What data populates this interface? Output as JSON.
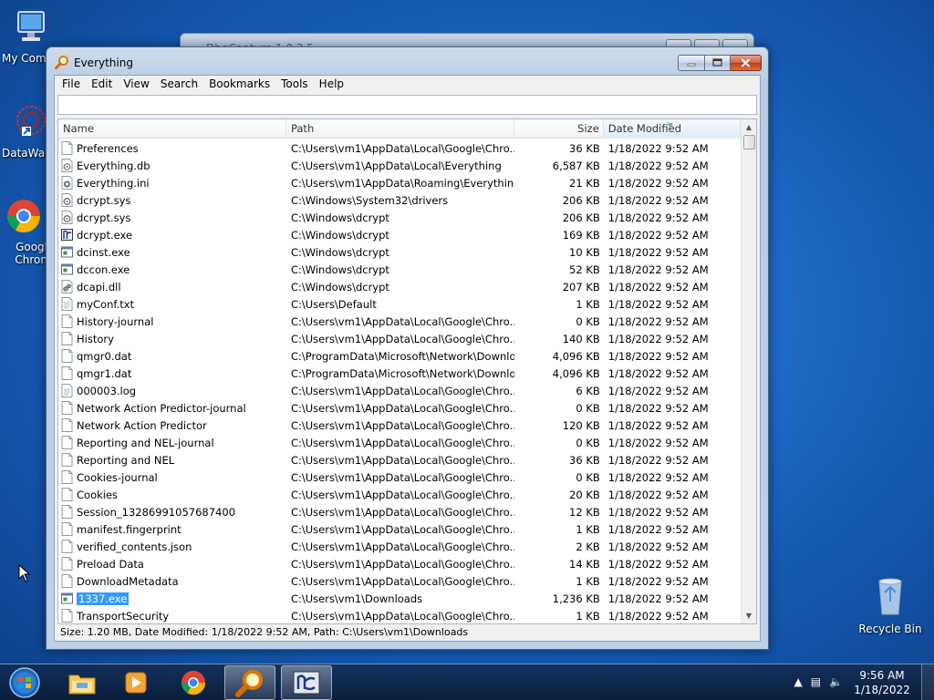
{
  "desktop": {
    "icons": [
      {
        "label": "My Comp",
        "icon": "computer-icon"
      },
      {
        "label": "DataWag",
        "icon": "datawag-icon"
      },
      {
        "label": "Googl\nChron",
        "icon": "chrome-icon"
      },
      {
        "label": "Recycle Bin",
        "icon": "recycle-bin-icon"
      }
    ]
  },
  "background_window": {
    "title": "DbgCapture 1.0.3.5"
  },
  "window": {
    "title": "Everything",
    "menu": [
      "File",
      "Edit",
      "View",
      "Search",
      "Bookmarks",
      "Tools",
      "Help"
    ],
    "search": {
      "value": "",
      "placeholder": ""
    },
    "columns": {
      "name": "Name",
      "path": "Path",
      "size": "Size",
      "date": "Date Modified"
    },
    "sorted_column": "Date Modified",
    "rows": [
      {
        "name": "Preferences",
        "path": "C:\\Users\\vm1\\AppData\\Local\\Google\\Chro...",
        "size": "36 KB",
        "date": "1/18/2022 9:52 AM",
        "icon": "file"
      },
      {
        "name": "Everything.db",
        "path": "C:\\Users\\vm1\\AppData\\Local\\Everything",
        "size": "6,587 KB",
        "date": "1/18/2022 9:52 AM",
        "icon": "db"
      },
      {
        "name": "Everything.ini",
        "path": "C:\\Users\\vm1\\AppData\\Roaming\\Everything",
        "size": "21 KB",
        "date": "1/18/2022 9:52 AM",
        "icon": "ini"
      },
      {
        "name": "dcrypt.sys",
        "path": "C:\\Windows\\System32\\drivers",
        "size": "206 KB",
        "date": "1/18/2022 9:52 AM",
        "icon": "sys"
      },
      {
        "name": "dcrypt.sys",
        "path": "C:\\Windows\\dcrypt",
        "size": "206 KB",
        "date": "1/18/2022 9:52 AM",
        "icon": "sys"
      },
      {
        "name": "dcrypt.exe",
        "path": "C:\\Windows\\dcrypt",
        "size": "169 KB",
        "date": "1/18/2022 9:52 AM",
        "icon": "dcexe"
      },
      {
        "name": "dcinst.exe",
        "path": "C:\\Windows\\dcrypt",
        "size": "10 KB",
        "date": "1/18/2022 9:52 AM",
        "icon": "exe"
      },
      {
        "name": "dccon.exe",
        "path": "C:\\Windows\\dcrypt",
        "size": "52 KB",
        "date": "1/18/2022 9:52 AM",
        "icon": "exe"
      },
      {
        "name": "dcapi.dll",
        "path": "C:\\Windows\\dcrypt",
        "size": "207 KB",
        "date": "1/18/2022 9:52 AM",
        "icon": "dll"
      },
      {
        "name": "myConf.txt",
        "path": "C:\\Users\\Default",
        "size": "1 KB",
        "date": "1/18/2022 9:52 AM",
        "icon": "txt"
      },
      {
        "name": "History-journal",
        "path": "C:\\Users\\vm1\\AppData\\Local\\Google\\Chro...",
        "size": "0 KB",
        "date": "1/18/2022 9:52 AM",
        "icon": "file"
      },
      {
        "name": "History",
        "path": "C:\\Users\\vm1\\AppData\\Local\\Google\\Chro...",
        "size": "140 KB",
        "date": "1/18/2022 9:52 AM",
        "icon": "file"
      },
      {
        "name": "qmgr0.dat",
        "path": "C:\\ProgramData\\Microsoft\\Network\\Downlo...",
        "size": "4,096 KB",
        "date": "1/18/2022 9:52 AM",
        "icon": "file"
      },
      {
        "name": "qmgr1.dat",
        "path": "C:\\ProgramData\\Microsoft\\Network\\Downlo...",
        "size": "4,096 KB",
        "date": "1/18/2022 9:52 AM",
        "icon": "file"
      },
      {
        "name": "000003.log",
        "path": "C:\\Users\\vm1\\AppData\\Local\\Google\\Chro...",
        "size": "6 KB",
        "date": "1/18/2022 9:52 AM",
        "icon": "txt"
      },
      {
        "name": "Network Action Predictor-journal",
        "path": "C:\\Users\\vm1\\AppData\\Local\\Google\\Chro...",
        "size": "0 KB",
        "date": "1/18/2022 9:52 AM",
        "icon": "file"
      },
      {
        "name": "Network Action Predictor",
        "path": "C:\\Users\\vm1\\AppData\\Local\\Google\\Chro...",
        "size": "120 KB",
        "date": "1/18/2022 9:52 AM",
        "icon": "file"
      },
      {
        "name": "Reporting and NEL-journal",
        "path": "C:\\Users\\vm1\\AppData\\Local\\Google\\Chro...",
        "size": "0 KB",
        "date": "1/18/2022 9:52 AM",
        "icon": "file"
      },
      {
        "name": "Reporting and NEL",
        "path": "C:\\Users\\vm1\\AppData\\Local\\Google\\Chro...",
        "size": "36 KB",
        "date": "1/18/2022 9:52 AM",
        "icon": "file"
      },
      {
        "name": "Cookies-journal",
        "path": "C:\\Users\\vm1\\AppData\\Local\\Google\\Chro...",
        "size": "0 KB",
        "date": "1/18/2022 9:52 AM",
        "icon": "file"
      },
      {
        "name": "Cookies",
        "path": "C:\\Users\\vm1\\AppData\\Local\\Google\\Chro...",
        "size": "20 KB",
        "date": "1/18/2022 9:52 AM",
        "icon": "file"
      },
      {
        "name": "Session_13286991057687400",
        "path": "C:\\Users\\vm1\\AppData\\Local\\Google\\Chro...",
        "size": "12 KB",
        "date": "1/18/2022 9:52 AM",
        "icon": "file"
      },
      {
        "name": "manifest.fingerprint",
        "path": "C:\\Users\\vm1\\AppData\\Local\\Google\\Chro...",
        "size": "1 KB",
        "date": "1/18/2022 9:52 AM",
        "icon": "file"
      },
      {
        "name": "verified_contents.json",
        "path": "C:\\Users\\vm1\\AppData\\Local\\Google\\Chro...",
        "size": "2 KB",
        "date": "1/18/2022 9:52 AM",
        "icon": "file"
      },
      {
        "name": "Preload Data",
        "path": "C:\\Users\\vm1\\AppData\\Local\\Google\\Chro...",
        "size": "14 KB",
        "date": "1/18/2022 9:52 AM",
        "icon": "file"
      },
      {
        "name": "DownloadMetadata",
        "path": "C:\\Users\\vm1\\AppData\\Local\\Google\\Chro...",
        "size": "1 KB",
        "date": "1/18/2022 9:52 AM",
        "icon": "file"
      },
      {
        "name": "1337.exe",
        "path": "C:\\Users\\vm1\\Downloads",
        "size": "1,236 KB",
        "date": "1/18/2022 9:52 AM",
        "icon": "exe",
        "selected": true
      },
      {
        "name": "TransportSecurity",
        "path": "C:\\Users\\vm1\\AppData\\Local\\Google\\Chro...",
        "size": "1 KB",
        "date": "1/18/2022 9:52 AM",
        "icon": "file"
      }
    ],
    "status": "Size: 1.20 MB, Date Modified: 1/18/2022 9:52 AM, Path: C:\\Users\\vm1\\Downloads"
  },
  "taskbar": {
    "items": [
      "start-orb-icon",
      "explorer-icon",
      "media-player-icon",
      "chrome-icon",
      "everything-icon",
      "dcrypt-icon"
    ],
    "active_items": [
      "everything-icon",
      "dcrypt-icon"
    ],
    "clock_time": "9:56 AM",
    "clock_date": "1/18/2022"
  },
  "colors": {
    "selection": "#3399ff",
    "desktop": "#1f6cc8"
  }
}
